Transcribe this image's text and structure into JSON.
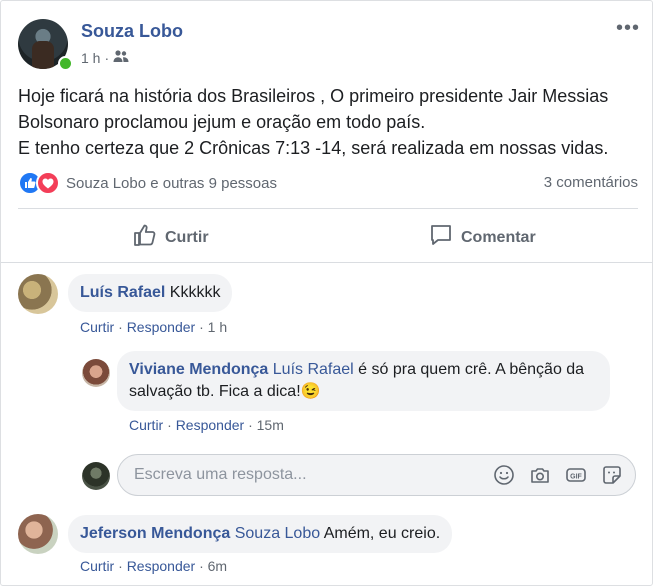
{
  "post": {
    "author": "Souza Lobo",
    "time": "1 h",
    "more": "•••",
    "text_lines": [
      "Hoje ficará na história dos Brasileiros , O primeiro presidente Jair Messias Bolsonaro proclamou jejum e oração em todo país.",
      "E tenho certeza que 2 Crônicas 7:13 -14, será realizada em nossas vidas."
    ],
    "reactions_text": "Souza Lobo e outras 9 pessoas",
    "comments_count": "3 comentários"
  },
  "actions": {
    "like": "Curtir",
    "comment": "Comentar"
  },
  "comments": [
    {
      "name": "Luís Rafael",
      "mention": "",
      "text": " Kkkkkk",
      "like": "Curtir",
      "reply": "Responder",
      "time": "1 h"
    },
    {
      "name": "Viviane Mendonça",
      "mention": "Luís Rafael",
      "text": " é só pra quem crê. A bênção da salvação tb. Fica a dica!😉",
      "like": "Curtir",
      "reply": "Responder",
      "time": "15m"
    },
    {
      "name": "Jeferson Mendonça",
      "mention": "Souza Lobo",
      "text": " Amém, eu creio.",
      "like": "Curtir",
      "reply": "Responder",
      "time": "6m"
    }
  ],
  "reply": {
    "placeholder": "Escreva uma resposta..."
  },
  "icons": {
    "audience": "friends-icon",
    "like_reaction": "like-reaction-icon",
    "love_reaction": "love-reaction-icon",
    "emoji": "emoji-icon",
    "camera": "camera-icon",
    "gif": "gif-icon",
    "sticker": "sticker-icon"
  },
  "colors": {
    "link": "#385898",
    "like_blue": "#2078f4",
    "love_red": "#f33e58",
    "online_green": "#42b72a"
  }
}
